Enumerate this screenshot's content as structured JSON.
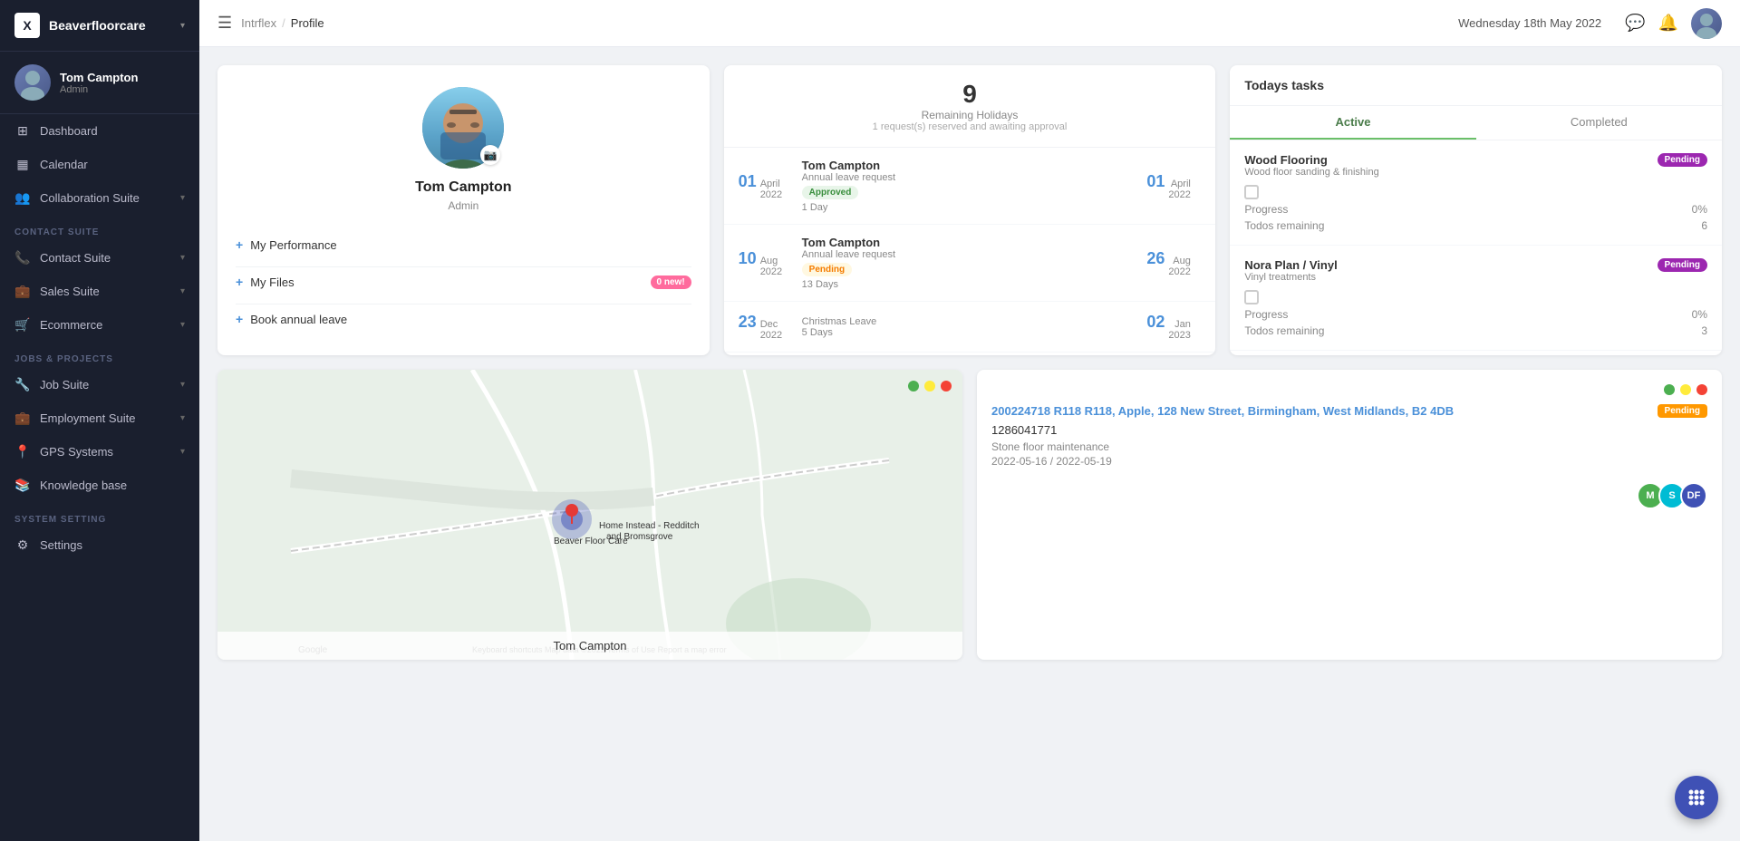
{
  "brand": {
    "logo": "X",
    "name": "Beaverfloorcare",
    "chevron": "▾"
  },
  "user": {
    "name": "Tom Campton",
    "role": "Admin"
  },
  "sidebar": {
    "items": [
      {
        "id": "dashboard",
        "icon": "⊞",
        "label": "Dashboard",
        "section": null
      },
      {
        "id": "calendar",
        "icon": "📅",
        "label": "Calendar",
        "section": null
      },
      {
        "id": "collaboration-suite",
        "icon": "👥",
        "label": "Collaboration Suite",
        "section": null,
        "chevron": "▾"
      },
      {
        "id": "contact-suite-label",
        "label": "CONTACT SUITE",
        "section_label": true
      },
      {
        "id": "contact-suite",
        "icon": "📞",
        "label": "Contact Suite",
        "section": null,
        "chevron": "▾"
      },
      {
        "id": "sales-suite",
        "icon": "💼",
        "label": "Sales Suite",
        "section": null,
        "chevron": "▾"
      },
      {
        "id": "ecommerce",
        "icon": "🛒",
        "label": "Ecommerce",
        "section": null,
        "chevron": "▾"
      },
      {
        "id": "jobs-projects-label",
        "label": "JOBS & PROJECTS",
        "section_label": true
      },
      {
        "id": "job-suite",
        "icon": "🔧",
        "label": "Job Suite",
        "section": null,
        "chevron": "▾"
      },
      {
        "id": "employment-suite",
        "icon": "💼",
        "label": "Employment Suite",
        "section": null,
        "chevron": "▾"
      },
      {
        "id": "gps-systems",
        "icon": "📍",
        "label": "GPS Systems",
        "section": null,
        "chevron": "▾"
      },
      {
        "id": "knowledge-base",
        "icon": "📚",
        "label": "Knowledge base",
        "section": null
      },
      {
        "id": "system-setting-label",
        "label": "SYSTEM SETTING",
        "section_label": true
      },
      {
        "id": "settings",
        "icon": "⚙️",
        "label": "Settings",
        "section": null
      }
    ]
  },
  "topbar": {
    "breadcrumb_root": "Intrflex",
    "breadcrumb_sep": "/",
    "breadcrumb_current": "Profile",
    "date": "Wednesday 18th May 2022"
  },
  "profile_card": {
    "name": "Tom Campton",
    "role": "Admin",
    "actions": [
      {
        "id": "my-performance",
        "label": "My Performance",
        "badge": null
      },
      {
        "id": "my-files",
        "label": "My Files",
        "badge": "0 new!"
      },
      {
        "id": "book-annual-leave",
        "label": "Book annual leave",
        "badge": null
      }
    ]
  },
  "holiday_card": {
    "count": "9",
    "label": "Remaining Holidays",
    "sub": "1 request(s) reserved and awaiting approval",
    "items": [
      {
        "start_day": "01",
        "start_month": "April",
        "start_year": "2022",
        "person": "Tom Campton",
        "type": "Annual leave request",
        "status": "Approved",
        "duration": "1 Day",
        "end_day": "01",
        "end_month": "April",
        "end_year": "2022"
      },
      {
        "start_day": "10",
        "start_month": "Aug",
        "start_year": "2022",
        "person": "Tom Campton",
        "type": "Annual leave request",
        "status": "Pending",
        "duration": "13 Days",
        "end_day": "26",
        "end_month": "Aug",
        "end_year": "2022"
      },
      {
        "start_day": "23",
        "start_month": "Dec",
        "start_year": "2022",
        "person": "",
        "type": "Christmas Leave",
        "status": "",
        "duration": "5 Days",
        "end_day": "02",
        "end_month": "Jan",
        "end_year": "2023"
      }
    ]
  },
  "tasks_card": {
    "title": "Todays tasks",
    "tabs": [
      {
        "id": "active",
        "label": "Active",
        "active": true
      },
      {
        "id": "completed",
        "label": "Completed",
        "active": false
      }
    ],
    "tasks": [
      {
        "id": "task-1",
        "title": "Wood Flooring",
        "subtitle": "Wood floor sanding & finishing",
        "status": "Pending",
        "progress_label": "Progress",
        "progress_value": "0%",
        "todos_label": "Todos remaining",
        "todos_value": "6"
      },
      {
        "id": "task-2",
        "title": "Nora Plan / Vinyl",
        "subtitle": "Vinyl treatments",
        "status": "Pending",
        "progress_label": "Progress",
        "progress_value": "0%",
        "todos_label": "Todos remaining",
        "todos_value": "3"
      }
    ]
  },
  "map_card": {
    "dots": [
      "#4caf50",
      "#ffeb3b",
      "#f44336"
    ],
    "location_name": "Tom Campton"
  },
  "job_card": {
    "dots": [
      "#4caf50",
      "#ffeb3b",
      "#f44336"
    ],
    "address": "200224718 R118 R118, Apple, 128 New Street, Birmingham, West Midlands, B2 4DB",
    "status": "Pending",
    "phone": "1286041771",
    "type": "Stone floor maintenance",
    "dates": "2022-05-16 / 2022-05-19",
    "avatars": [
      {
        "initials": "M",
        "color": "av-green"
      },
      {
        "initials": "S",
        "color": "av-teal"
      },
      {
        "initials": "DF",
        "color": "av-blue"
      }
    ]
  },
  "fab": {
    "icon": "⋮⋮⋮"
  }
}
